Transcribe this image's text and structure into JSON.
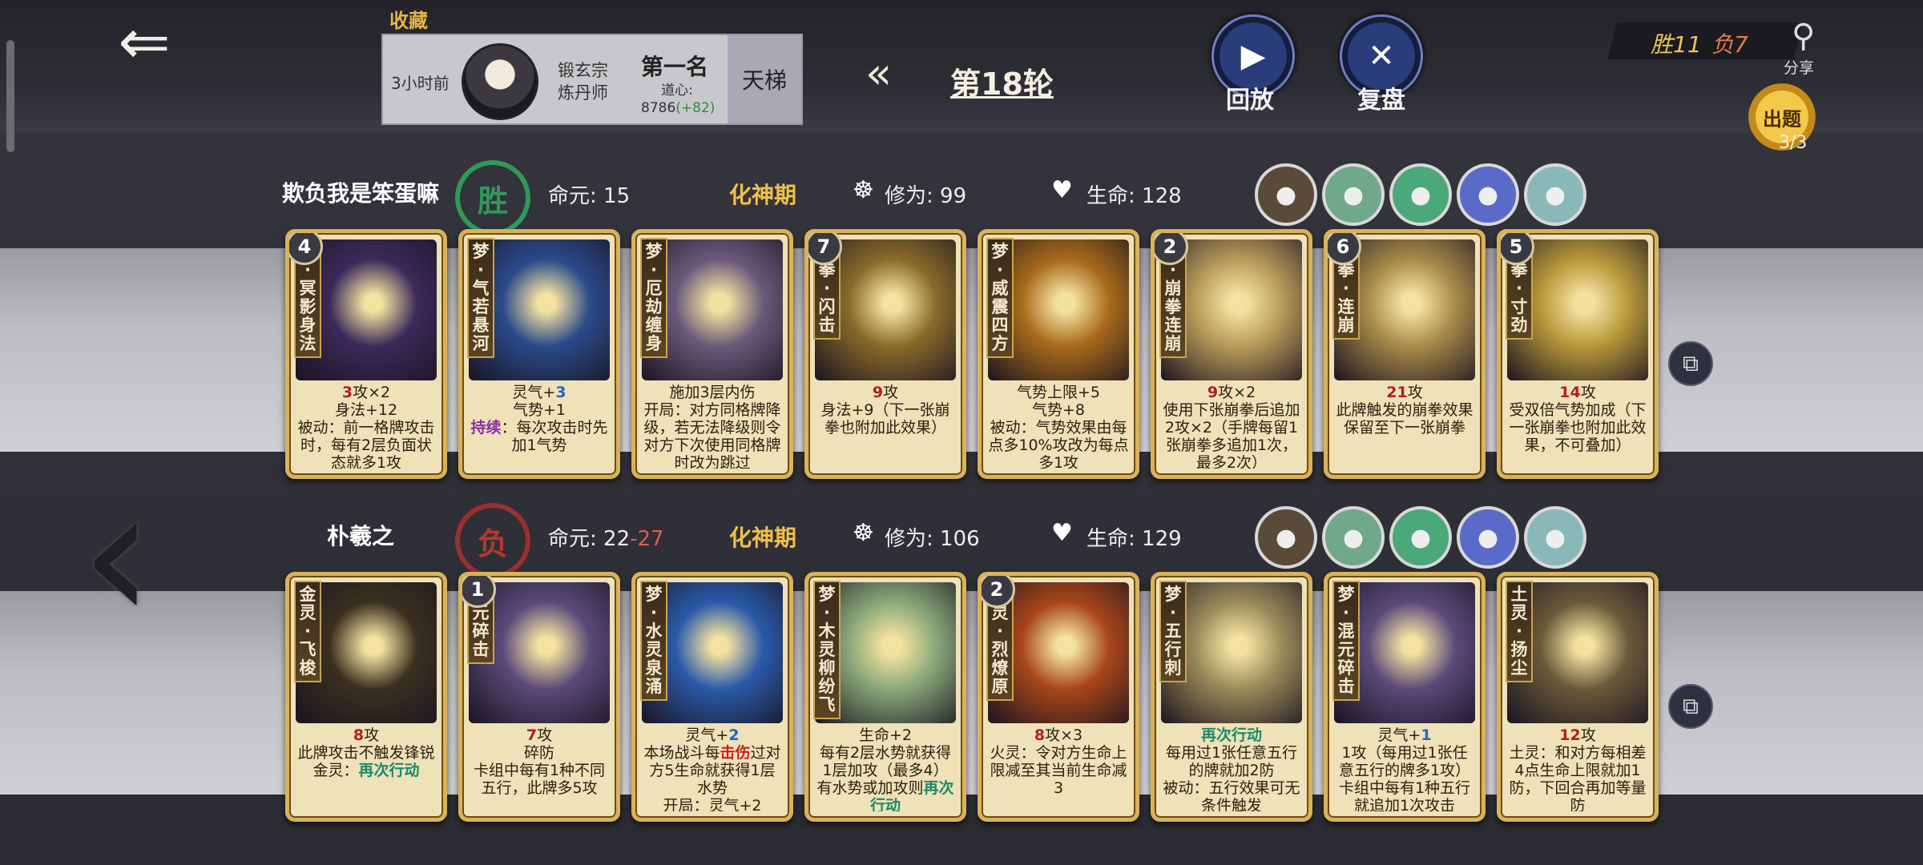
{
  "header": {
    "favorites_label": "收藏",
    "record": {
      "time": "3小时前",
      "sect_line1": "锻玄宗",
      "sect_line2": "炼丹师",
      "rank": "第一名",
      "dao_label": "道心:",
      "dao_value": "8786",
      "dao_gain": "(+82)",
      "mode": "天梯"
    },
    "round": "第18轮",
    "replay_label": "回放",
    "review_label": "复盘",
    "wins": "胜11",
    "losses": "负7",
    "share_label": "分享",
    "quiz_label": "出题",
    "quiz_count": "3/3"
  },
  "players": [
    {
      "name": "欺负我是笨蛋嘛",
      "result": "胜",
      "life_label": "命元:",
      "life_value": "15",
      "life_extra": "",
      "realm": "化神期",
      "cultivation_label": "修为:",
      "cultivation": "99",
      "hp_label": "生命:",
      "hp": "128",
      "tokens": [
        "sun-token-icon",
        "crane-token-icon",
        "strongman-token-icon",
        "book-token-icon",
        "fist-token-icon"
      ],
      "cards": [
        {
          "level": "4",
          "name": "梦·冥影身法",
          "art": "#3a2a5a",
          "text_parts": [
            {
              "t": "3",
              "c": "atk"
            },
            {
              "t": "攻×2\n身法+12\n被动：前一格牌攻击时，每有2层负面状态就多1攻",
              "c": ""
            }
          ]
        },
        {
          "level": "",
          "name": "梦·气若悬河",
          "art": "#2a4a8a",
          "text_parts": [
            {
              "t": "灵气+",
              "c": ""
            },
            {
              "t": "3",
              "c": "blue"
            },
            {
              "t": "\n气势+1\n",
              "c": ""
            },
            {
              "t": "持续",
              "c": "purple"
            },
            {
              "t": "：每次攻击时先加1气势",
              "c": ""
            }
          ]
        },
        {
          "level": "",
          "name": "梦·厄劫缠身",
          "art": "#6a5a7a",
          "text_parts": [
            {
              "t": "施加3层内伤\n开局：对方同格牌降级，若无法降级则令对方下次使用同格牌时改为跳过",
              "c": ""
            }
          ]
        },
        {
          "level": "7",
          "name": "崩拳·闪击",
          "art": "#8a6a2a",
          "text_parts": [
            {
              "t": "9",
              "c": "atk"
            },
            {
              "t": "攻\n身法+9（下一张崩拳也附加此效果）",
              "c": ""
            }
          ]
        },
        {
          "level": "",
          "name": "梦·威震四方",
          "art": "#a86a1a",
          "text_parts": [
            {
              "t": "气势上限+5\n气势+8\n被动：气势效果由每点多10%攻改为每点多1攻",
              "c": ""
            }
          ]
        },
        {
          "level": "2",
          "name": "梦·崩拳连崩",
          "art": "#b89a5a",
          "text_parts": [
            {
              "t": "9",
              "c": "atk"
            },
            {
              "t": "攻×2\n使用下张崩拳后追加2攻×2（手牌每留1张崩拳多追加1次，最多2次）",
              "c": ""
            }
          ]
        },
        {
          "level": "6",
          "name": "崩拳·连崩",
          "art": "#a88a4a",
          "text_parts": [
            {
              "t": "21",
              "c": "atk"
            },
            {
              "t": "攻\n此牌触发的崩拳效果保留至下一张崩拳",
              "c": ""
            }
          ]
        },
        {
          "level": "5",
          "name": "崩拳·寸劲",
          "art": "#b8983a",
          "text_parts": [
            {
              "t": "14",
              "c": "atk"
            },
            {
              "t": "攻\n受双倍气势加成（下一张崩拳也附加此效果，不可叠加）",
              "c": ""
            }
          ]
        }
      ]
    },
    {
      "name": "朴羲之",
      "result": "负",
      "life_label": "命元:",
      "life_value": "22",
      "life_extra": "-27",
      "realm": "化神期",
      "cultivation_label": "修为:",
      "cultivation": "106",
      "hp_label": "生命:",
      "hp": "129",
      "tokens": [
        "wood-token-icon",
        "sage-token-icon",
        "gold-token-icon",
        "scholar-token-icon",
        "book-token-icon"
      ],
      "cards": [
        {
          "level": "",
          "name": "金灵·飞梭",
          "art": "#3a3020",
          "text_parts": [
            {
              "t": "8",
              "c": "atk"
            },
            {
              "t": "攻\n此牌攻击不触发锋锐\n金灵：",
              "c": ""
            },
            {
              "t": "再次行动",
              "c": "green"
            }
          ]
        },
        {
          "level": "1",
          "name": "混元碎击",
          "art": "#5a4a7a",
          "text_parts": [
            {
              "t": "7",
              "c": "atk"
            },
            {
              "t": "攻\n碎防\n卡组中每有1种不同五行，此牌多5攻",
              "c": ""
            }
          ]
        },
        {
          "level": "",
          "name": "梦·水灵泉涌",
          "art": "#2a5aaa",
          "text_parts": [
            {
              "t": "灵气+",
              "c": ""
            },
            {
              "t": "2",
              "c": "blue"
            },
            {
              "t": "\n本场战斗每",
              "c": ""
            },
            {
              "t": "击伤",
              "c": "red"
            },
            {
              "t": "过对方5生命就获得1层水势\n开局：灵气+2",
              "c": ""
            }
          ]
        },
        {
          "level": "",
          "name": "梦·木灵柳纷飞",
          "art": "#8aa87a",
          "text_parts": [
            {
              "t": "生命+2\n每有2层水势就获得1层加攻（最多4）\n有水势或加攻则",
              "c": ""
            },
            {
              "t": "再次行动",
              "c": "green"
            }
          ]
        },
        {
          "level": "2",
          "name": "火灵·烈燎原",
          "art": "#a8461a",
          "text_parts": [
            {
              "t": "8",
              "c": "atk"
            },
            {
              "t": "攻×3\n火灵：令对方生命上限减至其当前生命减3",
              "c": ""
            }
          ]
        },
        {
          "level": "",
          "name": "梦·五行刺",
          "art": "#9a8a5a",
          "text_parts": [
            {
              "t": "再次行动",
              "c": "green"
            },
            {
              "t": "\n每用过1张任意五行的牌就加2防\n被动：五行效果可无条件触发",
              "c": ""
            }
          ]
        },
        {
          "level": "",
          "name": "梦·混元碎击",
          "art": "#5a4a7a",
          "text_parts": [
            {
              "t": "灵气+",
              "c": ""
            },
            {
              "t": "1",
              "c": "blue"
            },
            {
              "t": "\n1攻（每用过1张任意五行的牌多1攻）\n卡组中每有1种五行就追加1次攻击",
              "c": ""
            }
          ]
        },
        {
          "level": "",
          "name": "土灵·扬尘",
          "art": "#6a5a3a",
          "text_parts": [
            {
              "t": "12",
              "c": "atk"
            },
            {
              "t": "攻\n土灵：和对方每相差4点生命上限就加1防，下回合再加等量防",
              "c": ""
            }
          ]
        }
      ]
    }
  ],
  "icons": {
    "back": "back-arrow-icon",
    "replay": "play-icon",
    "review": "crossed-swords-icon",
    "share": "share-icon",
    "cultivation": "meditation-icon",
    "hp": "heart-icon",
    "copy": "copy-icon",
    "prev": "chevron-left-icon"
  },
  "colors": {
    "gold": "#f0c04a",
    "win": "#2f9a58",
    "loss": "#b03a30",
    "card_border": "#d9b25a"
  }
}
